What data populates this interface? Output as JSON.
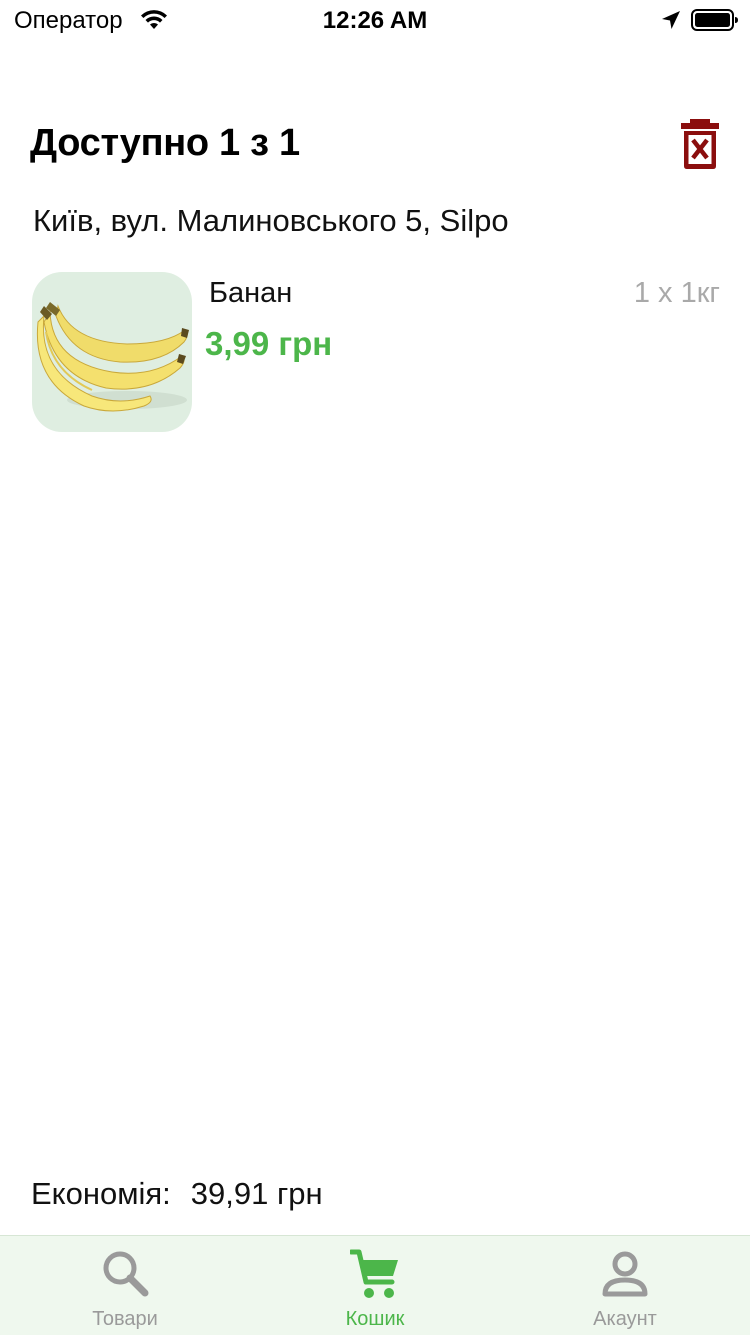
{
  "status_bar": {
    "carrier": "Оператор",
    "time": "12:26 AM"
  },
  "header": {
    "title": "Доступно 1 з 1"
  },
  "store": {
    "address": "Київ, вул. Малиновського 5, Silpo"
  },
  "cart": {
    "items": [
      {
        "name": "Банан",
        "price": "3,99 грн",
        "quantity": "1 x 1кг",
        "image": "banana"
      }
    ]
  },
  "savings": {
    "label": "Економія:",
    "value": "39,91 грн"
  },
  "tab_bar": {
    "tabs": [
      {
        "label": "Товари",
        "icon": "search-icon",
        "active": false
      },
      {
        "label": "Кошик",
        "icon": "cart-icon",
        "active": true
      },
      {
        "label": "Акаунт",
        "icon": "account-icon",
        "active": false
      }
    ]
  },
  "colors": {
    "accent_green": "#4cb64a",
    "trash_red": "#8b0e0e",
    "tab_bar_bg": "#eff8ee",
    "inactive_gray": "#9a9a9a"
  }
}
